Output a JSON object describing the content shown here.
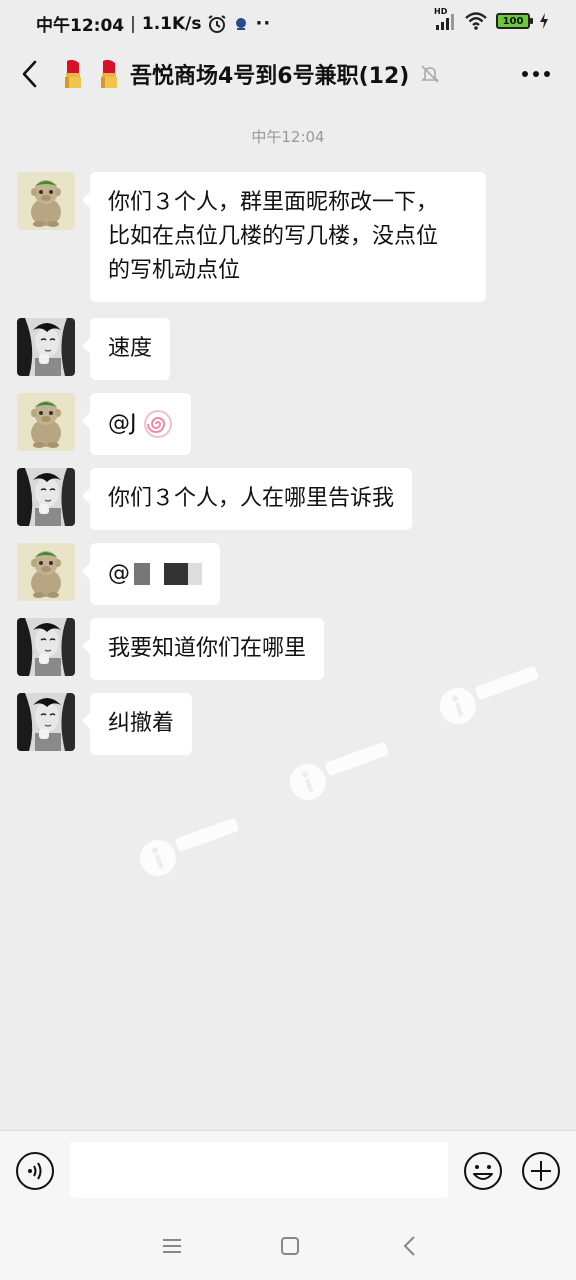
{
  "status_bar": {
    "time": "中午12:04",
    "network_speed": "1.1K/s",
    "hd_label": "HD",
    "battery": "100"
  },
  "header": {
    "title": "吾悦商场4号到6号兼职(12)"
  },
  "chat": {
    "timestamp": "中午12:04",
    "messages": [
      {
        "sender": "monkey",
        "text": "你们３个人，群里面昵称改一下，\n比如在点位几楼的写几楼，没点位\n的写机动点位"
      },
      {
        "sender": "girl",
        "text": "速度"
      },
      {
        "sender": "monkey",
        "text": "@J"
      },
      {
        "sender": "girl",
        "text": "你们３个人，人在哪里告诉我"
      },
      {
        "sender": "monkey",
        "text": "@"
      },
      {
        "sender": "girl",
        "text": "我要知道你们在哪里"
      },
      {
        "sender": "girl",
        "text": "纠撤着"
      }
    ]
  },
  "colors": {
    "background": "#ededed",
    "bubble": "#ffffff",
    "battery_green": "#6dc93a"
  }
}
